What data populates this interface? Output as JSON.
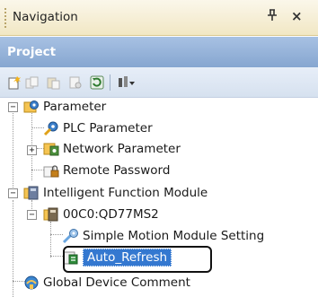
{
  "panel": {
    "title": "Navigation",
    "pin_glyph": "ᴪ",
    "close_glyph": "×"
  },
  "project": {
    "header": "Project"
  },
  "toolbar": {
    "icons": [
      "new-project-icon",
      "copy-icon",
      "paste-icon",
      "properties-icon",
      "refresh-icon",
      "filter-icon"
    ]
  },
  "tree": {
    "parameter": "Parameter",
    "plc_parameter": "PLC Parameter",
    "network_parameter": "Network Parameter",
    "remote_password": "Remote Password",
    "intelligent_module": "Intelligent Function Module",
    "module_00c0": "00C0:QD77MS2",
    "simple_motion_setting": "Simple Motion Module Setting",
    "auto_refresh": "Auto_Refresh",
    "global_device_comment": "Global Device Comment"
  },
  "colors": {
    "selection": "#3478d0",
    "project_header": "#96b3da",
    "title_bar": "#f4ecd0"
  }
}
